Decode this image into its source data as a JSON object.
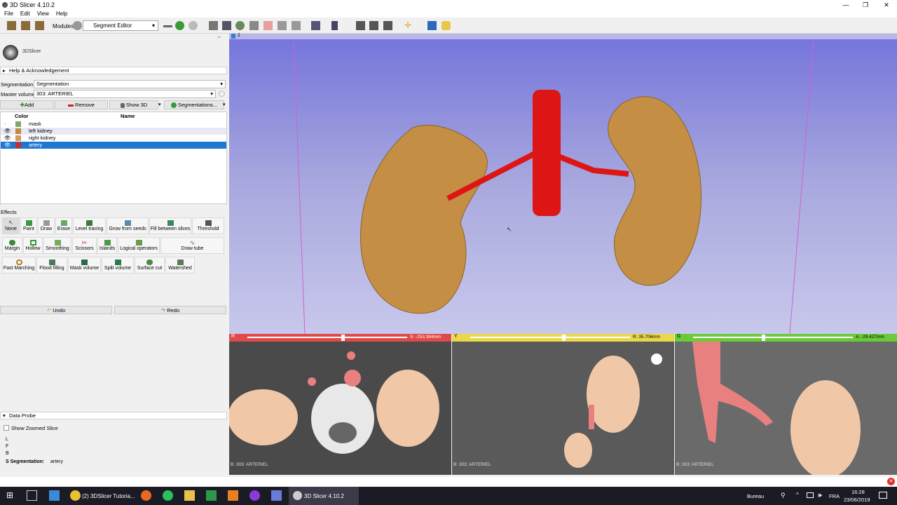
{
  "window": {
    "title": "3D Slicer 4.10.2",
    "controls": [
      "—",
      "❐",
      "✕"
    ]
  },
  "menu": [
    "File",
    "Edit",
    "View",
    "Help"
  ],
  "toolbar": {
    "modules_label": "Modules:",
    "module_value": "Segment Editor"
  },
  "logo_text": "3DSlicer",
  "help_header": "Help & Acknowledgement",
  "segmentation": {
    "label": "Segmentation:",
    "value": "Segmentation"
  },
  "master_volume": {
    "label": "Master volume:",
    "value": "303: ARTERIEL"
  },
  "actions": {
    "add": "Add",
    "remove": "Remove",
    "show3d": "Show 3D",
    "segmentations": "Segmentations..."
  },
  "table": {
    "col_color": "Color",
    "col_name": "Name",
    "rows": [
      {
        "name": "mask",
        "color": "#7fa86d"
      },
      {
        "name": "left kidney",
        "color": "#c08a45"
      },
      {
        "name": "right kidney",
        "color": "#d89a55"
      },
      {
        "name": "artery",
        "color": "#cc2a2a"
      }
    ]
  },
  "effects_label": "Effects",
  "effects": [
    "None",
    "Paint",
    "Draw",
    "Erase",
    "Level tracing",
    "Grow from seeds",
    "Fill between slices",
    "Threshold",
    "Margin",
    "Hollow",
    "Smoothing",
    "Scissors",
    "Islands",
    "Logical operators",
    "Draw tube",
    "Fast Marching",
    "Flood filling",
    "Mask volume",
    "Split volume",
    "Surface cut",
    "Watershed"
  ],
  "undo": "Undo",
  "redo": "Redo",
  "dataprobe": {
    "header": "Data Probe",
    "show_zoomed": "Show Zoomed Slice",
    "l": "L",
    "f": "F",
    "b": "B",
    "seg_label": "S Segmentation:",
    "seg_value": "artery"
  },
  "view3d_label": "1",
  "slices": [
    {
      "id": "R",
      "color": "#e04a4a",
      "value": "S: -253.384mm",
      "footer": "B: 303: ARTERIEL",
      "slider": 0.52
    },
    {
      "id": "Y",
      "color": "#e8d84a",
      "value": "R: 35.706mm",
      "footer": "B: 303: ARTERIEL",
      "slider": 0.52
    },
    {
      "id": "G",
      "color": "#6acb3a",
      "value": "A: -29.427mm",
      "footer": "B: 303: ARTERIEL",
      "slider": 0.52
    }
  ],
  "taskbar": {
    "chrome_tab": "(2) 3DSlicer Tutoria...",
    "slicer_tab": "3D Slicer 4.10.2",
    "desk": "Bureau",
    "lang": "FRA",
    "time": "16:28",
    "date": "23/06/2019"
  }
}
